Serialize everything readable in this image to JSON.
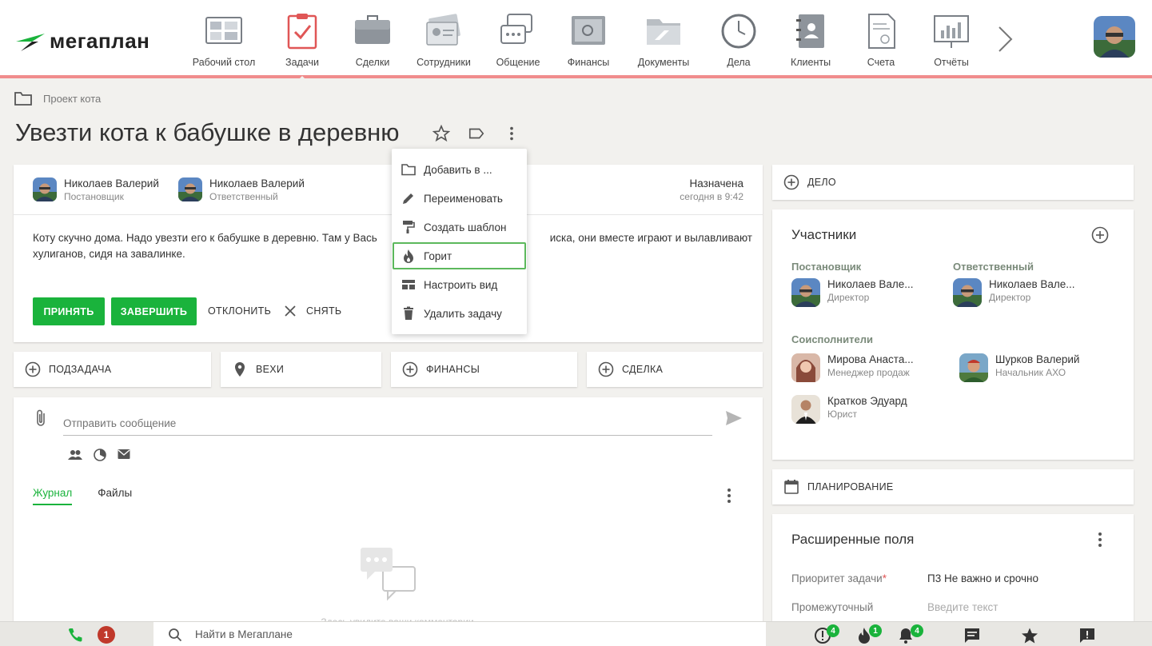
{
  "app": {
    "logo_text": "мегаплан",
    "colors": {
      "accent_green": "#1ab33c",
      "nav_underline": "#f08c8c",
      "background": "#f2f1ee"
    }
  },
  "nav": {
    "items": [
      {
        "label": "Рабочий стол",
        "icon": "desktop-icon"
      },
      {
        "label": "Задачи",
        "icon": "tasks-clipboard-icon",
        "active": true
      },
      {
        "label": "Сделки",
        "icon": "briefcase-icon"
      },
      {
        "label": "Сотрудники",
        "icon": "employees-icon"
      },
      {
        "label": "Общение",
        "icon": "chat-bubbles-icon"
      },
      {
        "label": "Финансы",
        "icon": "safe-icon"
      },
      {
        "label": "Документы",
        "icon": "folder-icon"
      },
      {
        "label": "Дела",
        "icon": "clock-icon"
      },
      {
        "label": "Клиенты",
        "icon": "contacts-book-icon"
      },
      {
        "label": "Счета",
        "icon": "invoice-icon"
      },
      {
        "label": "Отчёты",
        "icon": "report-chart-icon"
      }
    ],
    "next_icon": "chevron-right-icon"
  },
  "breadcrumb": {
    "label": "Проект кота"
  },
  "task": {
    "title": "Увезти кота к бабушке в деревню",
    "author": {
      "name": "Николаев Валерий",
      "role": "Постановщик"
    },
    "responsible": {
      "name": "Николаев Валерий",
      "role": "Ответственный"
    },
    "status": {
      "label": "Назначена",
      "time": "сегодня в 9:42"
    },
    "description_start": "Коту скучно дома. Надо увезти его к бабушке в деревню. Там у Вась",
    "description_end": "иска, они вместе играют и вылавливают",
    "description_line2": "хулиганов, сидя на завалинке.",
    "buttons": {
      "accept": "ПРИНЯТЬ",
      "complete": "ЗАВЕРШИТЬ",
      "reject": "ОТКЛОНИТЬ",
      "remove": "СНЯТЬ"
    }
  },
  "menu": {
    "items": [
      {
        "label": "Добавить в ...",
        "icon": "folder-icon"
      },
      {
        "label": "Переименовать",
        "icon": "pencil-icon"
      },
      {
        "label": "Создать шаблон",
        "icon": "paint-roller-icon"
      },
      {
        "label": "Горит",
        "icon": "fire-icon",
        "highlighted": true
      },
      {
        "label": "Настроить вид",
        "icon": "view-settings-icon"
      },
      {
        "label": "Удалить задачу",
        "icon": "trash-icon"
      }
    ]
  },
  "quick_add": {
    "subtask": "ПОДЗАДАЧА",
    "milestones": "ВЕХИ",
    "finance": "ФИНАНСЫ",
    "deal": "СДЕЛКА"
  },
  "composer": {
    "placeholder": "Отправить сообщение",
    "tabs": [
      "Журнал",
      "Файлы"
    ],
    "empty_text": "Здесь увидите ваши комментарии"
  },
  "right": {
    "deal_label": "ДЕЛО",
    "participants": {
      "title": "Участники",
      "author_label": "Постановщик",
      "responsible_label": "Ответственный",
      "author": {
        "name": "Николаев Вале...",
        "role": "Директор"
      },
      "responsible": {
        "name": "Николаев Вале...",
        "role": "Директор"
      },
      "coexecutors_label": "Соисполнители",
      "coexecutors": [
        {
          "name": "Мирова Анаста...",
          "role": "Менеджер продаж"
        },
        {
          "name": "Шурков Валерий",
          "role": "Начальник АХО"
        },
        {
          "name": "Кратков Эдуард",
          "role": "Юрист"
        }
      ]
    },
    "planning_label": "ПЛАНИРОВАНИЕ",
    "extended": {
      "title": "Расширенные поля",
      "priority_label": "Приоритет задачи",
      "priority_required": "*",
      "priority_value": "П3 Не важно и срочно",
      "intermediate_label": "Промежуточный",
      "intermediate_placeholder": "Введите текст"
    }
  },
  "bottom": {
    "missed_calls": "1",
    "search_placeholder": "Найти в Мегаплане",
    "alerts_count": "4",
    "fire_count": "1",
    "bell_count": "4"
  }
}
